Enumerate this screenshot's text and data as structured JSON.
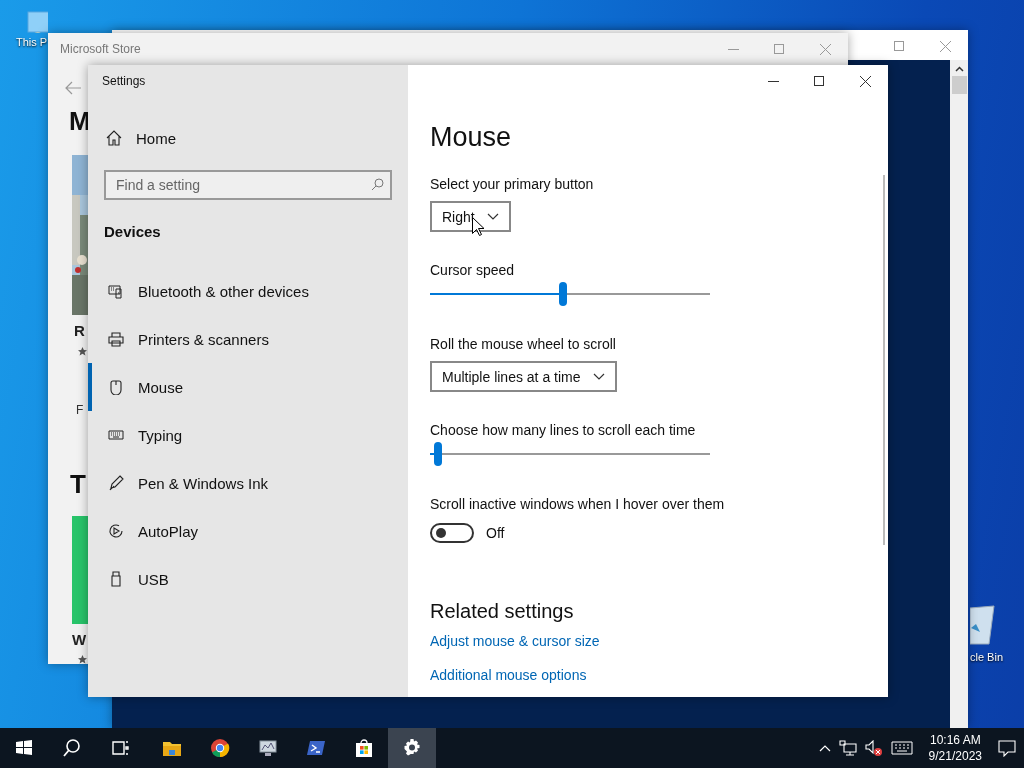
{
  "desktop": {
    "icons": [
      {
        "label": "This P"
      },
      {
        "label": "cle Bin"
      }
    ]
  },
  "store_window": {
    "title": "Microsoft Store",
    "headings": [
      "M",
      "T"
    ],
    "cards": [
      {
        "title": "R",
        "caption": "F"
      },
      {
        "title": "W"
      }
    ]
  },
  "settings_window": {
    "title": "Settings",
    "home": "Home",
    "search": {
      "placeholder": "Find a setting"
    },
    "section": "Devices",
    "nav": [
      {
        "label": "Bluetooth & other devices",
        "selected": false
      },
      {
        "label": "Printers & scanners",
        "selected": false
      },
      {
        "label": "Mouse",
        "selected": true
      },
      {
        "label": "Typing",
        "selected": false
      },
      {
        "label": "Pen & Windows Ink",
        "selected": false
      },
      {
        "label": "AutoPlay",
        "selected": false
      },
      {
        "label": "USB",
        "selected": false
      }
    ],
    "page_title": "Mouse",
    "settings": [
      {
        "kind": "dropdown",
        "label": "Select your primary button",
        "value": "Right"
      },
      {
        "kind": "slider",
        "label": "Cursor speed",
        "level": 0.475
      },
      {
        "kind": "dropdown",
        "label": "Roll the mouse wheel to scroll",
        "value": "Multiple lines at a time"
      },
      {
        "kind": "slider",
        "label": "Choose how many lines to scroll each time",
        "level": 0.03
      },
      {
        "kind": "toggle",
        "label": "Scroll inactive windows when I hover over them",
        "on": false,
        "state_text": "Off"
      }
    ],
    "related": {
      "title": "Related settings",
      "links": [
        "Adjust mouse & cursor size",
        "Additional mouse options"
      ]
    }
  },
  "taskbar": {
    "buttons": [
      {
        "selected": false
      },
      {
        "selected": false
      },
      {
        "selected": false
      },
      {
        "selected": false
      },
      {
        "selected": false
      },
      {
        "selected": false
      },
      {
        "selected": false
      },
      {
        "selected": false
      },
      {
        "selected": true
      }
    ],
    "clock": {
      "time": "10:16 AM",
      "date": "9/21/2023"
    }
  }
}
